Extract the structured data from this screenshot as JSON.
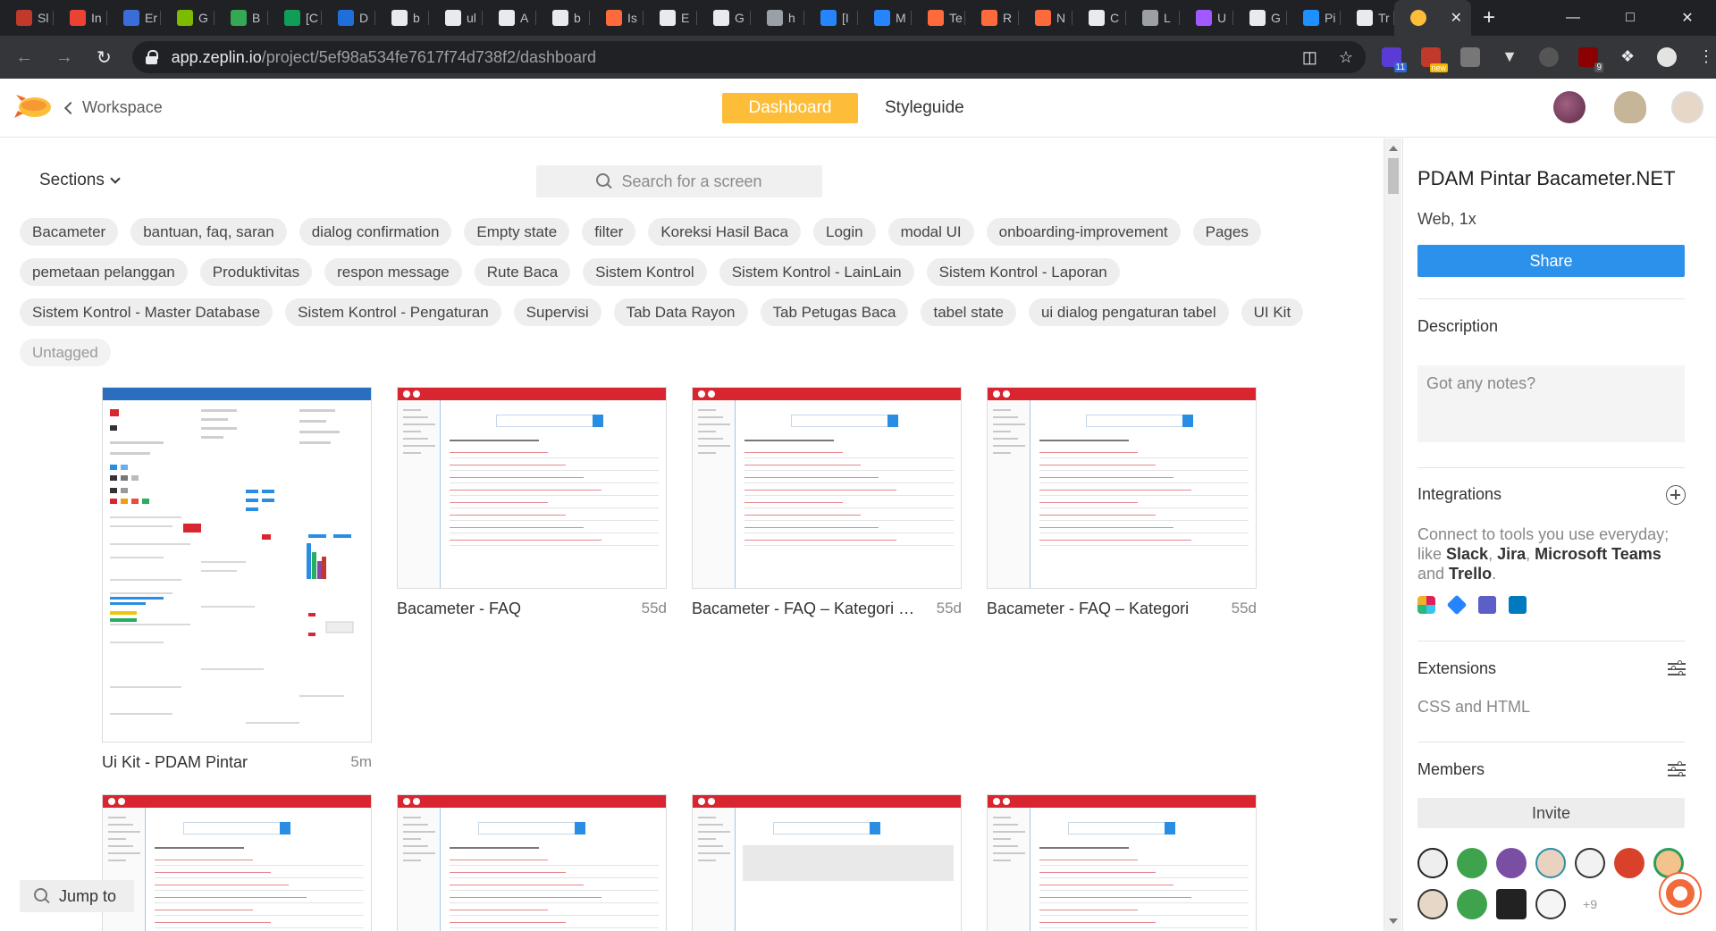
{
  "browser": {
    "tabs": [
      {
        "label": "Sl",
        "color": "#c0392b"
      },
      {
        "label": "In",
        "color": "#ea4335"
      },
      {
        "label": "Er",
        "color": "#3b6dd8"
      },
      {
        "label": "G",
        "color": "#7cbb00"
      },
      {
        "label": "B",
        "color": "#34a853"
      },
      {
        "label": "[C",
        "color": "#0f9d58"
      },
      {
        "label": "D",
        "color": "#1e6fd9"
      },
      {
        "label": "b",
        "color": "#e8eaed"
      },
      {
        "label": "ul",
        "color": "#e8eaed"
      },
      {
        "label": "A",
        "color": "#e8eaed"
      },
      {
        "label": "b",
        "color": "#e8eaed"
      },
      {
        "label": "Is",
        "color": "#ff6a3d"
      },
      {
        "label": "E",
        "color": "#e8eaed"
      },
      {
        "label": "G",
        "color": "#e8eaed"
      },
      {
        "label": "h",
        "color": "#9aa0a6"
      },
      {
        "label": "[I",
        "color": "#2684ff"
      },
      {
        "label": "M",
        "color": "#2684ff"
      },
      {
        "label": "Te",
        "color": "#ff6a3d"
      },
      {
        "label": "R",
        "color": "#ff6a3d"
      },
      {
        "label": "N",
        "color": "#ff6a3d"
      },
      {
        "label": "C",
        "color": "#e8eaed"
      },
      {
        "label": "L",
        "color": "#9aa0a6"
      },
      {
        "label": "U",
        "color": "#a259ff"
      },
      {
        "label": "G",
        "color": "#e8eaed"
      },
      {
        "label": "Pi",
        "color": "#1e90ff"
      },
      {
        "label": "Tr",
        "color": "#e8eaed"
      }
    ],
    "url_host": "app.zeplin.io",
    "url_path": "/project/5ef98a534fe7617f74d738f2/dashboard",
    "ext_badges": {
      "a": "11",
      "b": "new",
      "c": "9"
    }
  },
  "header": {
    "workspace_label": "Workspace",
    "tab_dashboard": "Dashboard",
    "tab_styleguide": "Styleguide"
  },
  "main": {
    "sections_label": "Sections",
    "search_placeholder": "Search for a screen",
    "jump_label": "Jump to",
    "tags": [
      "Bacameter",
      "bantuan, faq, saran",
      "dialog confirmation",
      "Empty state",
      "filter",
      "Koreksi Hasil Baca",
      "Login",
      "modal UI",
      "onboarding-improvement",
      "Pages",
      "pemetaan pelanggan",
      "Produktivitas",
      "respon message",
      "Rute Baca",
      "Sistem Kontrol",
      "Sistem Kontrol - LainLain",
      "Sistem Kontrol - Laporan",
      "Sistem Kontrol - Master Database",
      "Sistem Kontrol - Pengaturan",
      "Supervisi",
      "Tab Data Rayon",
      "Tab Petugas Baca",
      "tabel state",
      "ui dialog pengaturan tabel",
      "UI Kit"
    ],
    "tag_untagged": "Untagged",
    "screens": [
      {
        "title": "Ui Kit - PDAM Pintar",
        "age": "5m"
      },
      {
        "title": "Bacameter - FAQ",
        "age": "55d"
      },
      {
        "title": "Bacameter - FAQ – Kategori – Master Data",
        "age": "55d"
      },
      {
        "title": "Bacameter - FAQ – Kategori",
        "age": "55d"
      }
    ]
  },
  "panel": {
    "project_title": "PDAM Pintar Bacameter.NET",
    "platform": "Web, 1x",
    "share_label": "Share",
    "description_heading": "Description",
    "notes_placeholder": "Got any notes?",
    "integrations_heading": "Integrations",
    "integrations_prefix": "Connect to tools you use everyday; like ",
    "integrations_slack": "Slack",
    "integrations_jira": "Jira",
    "integrations_teams": "Microsoft Teams",
    "integrations_and": " and ",
    "integrations_trello": "Trello",
    "extensions_heading": "Extensions",
    "extensions_text": "CSS and HTML",
    "members_heading": "Members",
    "invite_label": "Invite",
    "members_more": "+9"
  },
  "colors": {
    "accent": "#fdbd39",
    "share": "#2c91ea",
    "brand_red": "#d9252f"
  }
}
